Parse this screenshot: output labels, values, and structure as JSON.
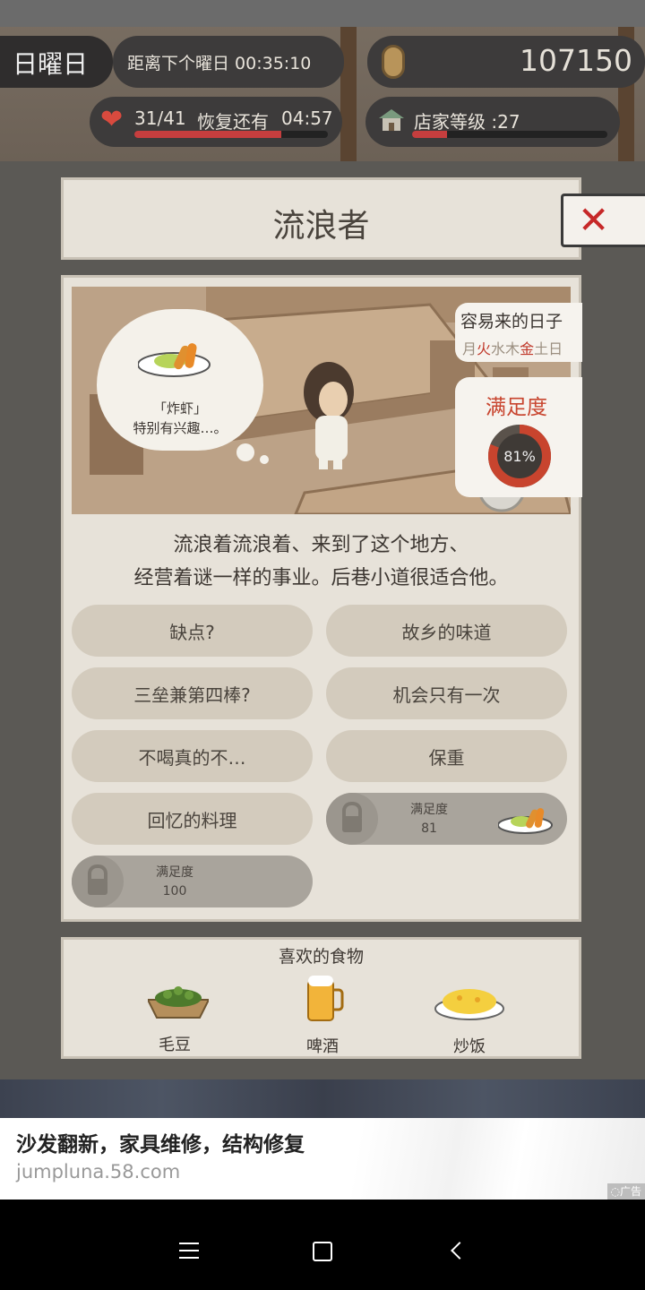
{
  "hud": {
    "day": "日曜日",
    "next_day_label": "距离下个曜日 00:35:10",
    "coins": "107150",
    "stamina": "31/41",
    "recover_label": "恢复还有",
    "recover_time": "04:57",
    "stamina_fraction": 0.76,
    "shop_level": "店家等级 :27",
    "shop_level_fraction": 0.18
  },
  "dialog": {
    "title": "流浪者",
    "close_icon": "close-x-icon",
    "thought": {
      "food_line": "「炸虾」",
      "interest_line": "特别有兴趣…。"
    },
    "days": {
      "label": "容易来的日子",
      "list": [
        "月",
        "火",
        "水",
        "木",
        "金",
        "土",
        "日"
      ],
      "highlight": [
        "火",
        "金"
      ],
      "highlight_color": "#c0392b"
    },
    "satisfaction": {
      "label": "满足度",
      "value_text": "81%",
      "value": 81
    },
    "description_line1": "流浪着流浪着、来到了这个地方、",
    "description_line2": "经营着谜一样的事业。后巷小道很适合他。",
    "options": [
      {
        "label": "缺点?"
      },
      {
        "label": "故乡的味道"
      },
      {
        "label": "三垒兼第四棒?"
      },
      {
        "label": "机会只有一次"
      },
      {
        "label": "不喝真的不…"
      },
      {
        "label": "保重"
      },
      {
        "label": "回忆的料理"
      }
    ],
    "locked": [
      {
        "label": "满足度",
        "value": "81"
      },
      {
        "label": "满足度",
        "value": "100"
      }
    ],
    "favorites": {
      "title": "喜欢的食物",
      "items": [
        {
          "name": "毛豆",
          "icon": "edamame-icon"
        },
        {
          "name": "啤酒",
          "icon": "beer-icon"
        },
        {
          "name": "炒饭",
          "icon": "fried-rice-icon"
        }
      ]
    }
  },
  "ad": {
    "title": "沙发翻新，家具维修，结构修复",
    "url": "jumpluna.58.com",
    "badge": "广告"
  },
  "colors": {
    "accent_red": "#c0392b",
    "panel_bg": "#e7e2d9"
  }
}
